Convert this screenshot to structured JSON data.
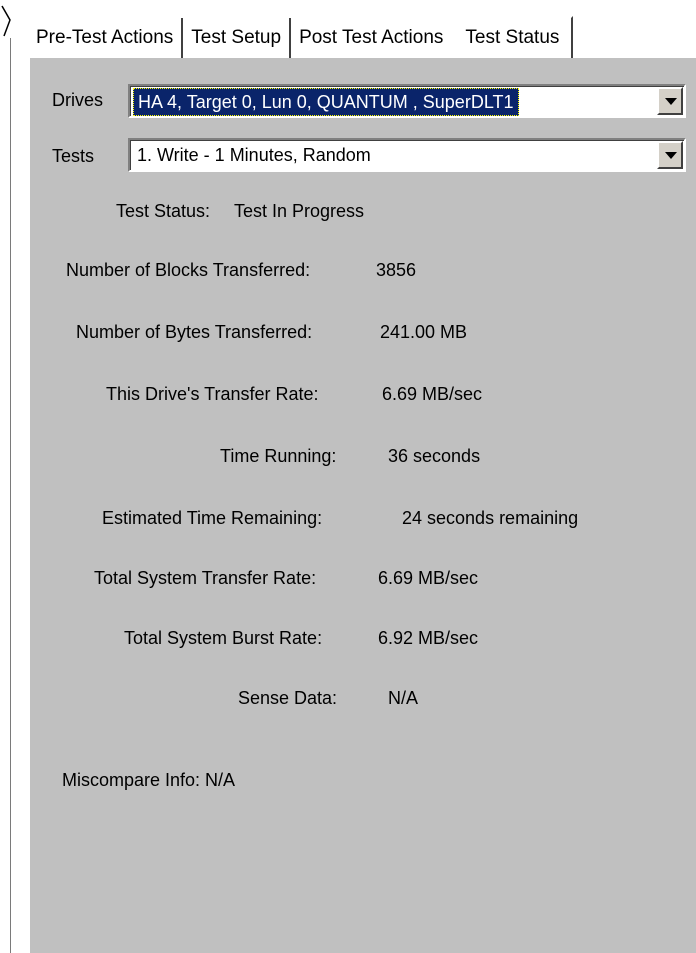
{
  "tabs": [
    {
      "label": "Pre-Test Actions"
    },
    {
      "label": "Test Setup"
    },
    {
      "label": "Post Test Actions"
    },
    {
      "label": "Test Status",
      "active": true
    }
  ],
  "drives": {
    "label": "Drives",
    "value": "HA 4, Target 0, Lun 0, QUANTUM , SuperDLT1"
  },
  "tests": {
    "label": "Tests",
    "value": "1.  Write - 1 Minutes, Random"
  },
  "status": {
    "test_status_label": "Test Status:",
    "test_status_value": "Test In Progress",
    "blocks_label": "Number of Blocks Transferred:",
    "blocks_value": "3856",
    "bytes_label": "Number of Bytes Transferred:",
    "bytes_value": "241.00 MB",
    "drive_rate_label": "This Drive's Transfer Rate:",
    "drive_rate_value": "6.69 MB/sec",
    "time_running_label": "Time Running:",
    "time_running_value": "36 seconds",
    "time_remaining_label": "Estimated Time Remaining:",
    "time_remaining_value": "24 seconds remaining",
    "system_rate_label": "Total System Transfer Rate:",
    "system_rate_value": "6.69 MB/sec",
    "burst_rate_label": "Total System Burst Rate:",
    "burst_rate_value": "6.92 MB/sec",
    "sense_label": "Sense Data:",
    "sense_value": "N/A",
    "miscompare": "Miscompare Info: N/A"
  },
  "colors": {
    "panel_bg": "#c0c0c0",
    "selection_bg": "#0a246a"
  }
}
